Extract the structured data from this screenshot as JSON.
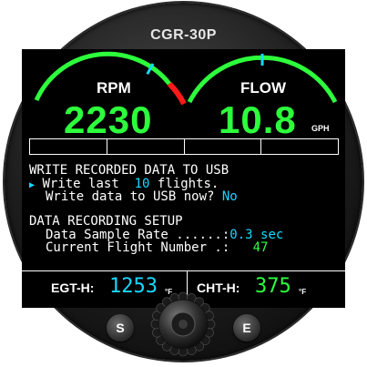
{
  "device": {
    "model": "CGR-30P"
  },
  "gauges": {
    "rpm": {
      "label": "RPM",
      "value": "2230",
      "needle_fraction": 0.73
    },
    "flow": {
      "label": "FLOW",
      "value": "10.8",
      "unit": "GPH",
      "needle_fraction": 0.5
    }
  },
  "colors": {
    "arc_green": "#2dff3c",
    "arc_red": "#ff1a1a",
    "needle": "#16d9ff",
    "value_green": "#2dff3c",
    "highlight_cyan": "#16d9ff"
  },
  "menu": {
    "write_header": "WRITE RECORDED DATA TO USB",
    "write_last_prefix": "Write last",
    "write_last_value": "10",
    "write_last_suffix": "flights.",
    "write_now_label": "Write data to USB now?",
    "write_now_value": "No",
    "setup_header": "DATA RECORDING SETUP",
    "sample_rate_label": "Data Sample Rate ......:",
    "sample_rate_value": "0.3 sec",
    "flight_number_label": "Current Flight Number .:",
    "flight_number_value": "47"
  },
  "footer": {
    "egt_label": "EGT-H:",
    "egt_value": "1253",
    "egt_unit": "°F",
    "cht_label": "CHT-H:",
    "cht_value": "375",
    "cht_unit": "°F"
  },
  "buttons": {
    "s_label": "S",
    "e_label": "E"
  },
  "icons": {
    "selection_cursor": "right-triangle",
    "knob": "rotary-knob"
  }
}
